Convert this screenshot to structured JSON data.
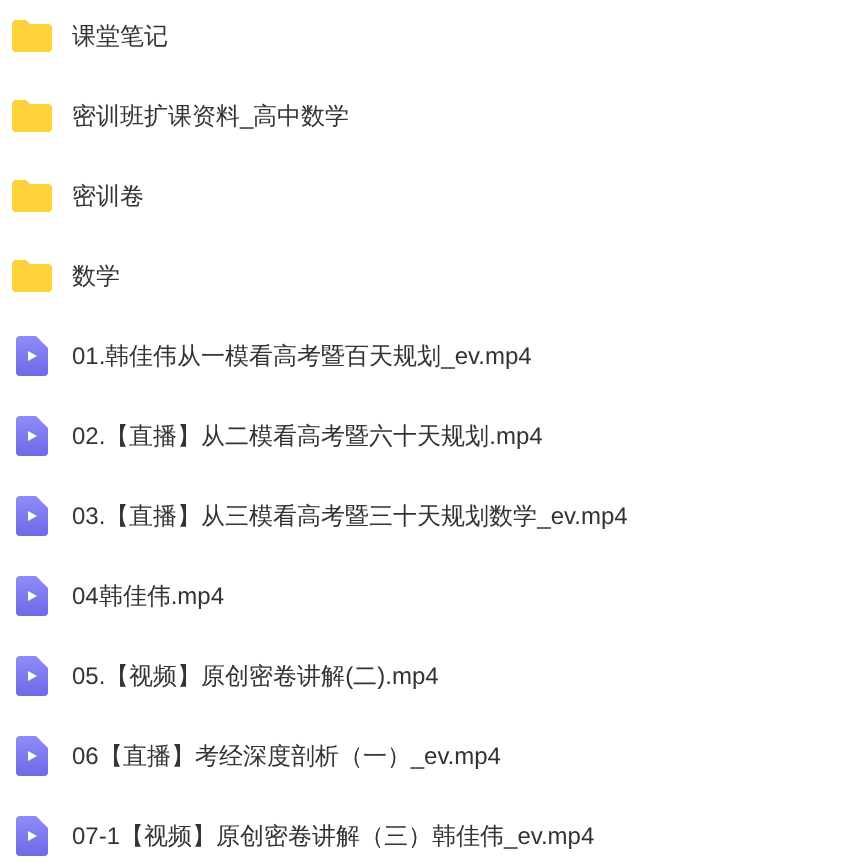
{
  "files": [
    {
      "kind": "folder",
      "name": "课堂笔记"
    },
    {
      "kind": "folder",
      "name": "密训班扩课资料_高中数学"
    },
    {
      "kind": "folder",
      "name": "密训卷"
    },
    {
      "kind": "folder",
      "name": "数学"
    },
    {
      "kind": "video",
      "name": "01.韩佳伟从一模看高考暨百天规划_ev.mp4"
    },
    {
      "kind": "video",
      "name": "02.【直播】从二模看高考暨六十天规划.mp4"
    },
    {
      "kind": "video",
      "name": "03.【直播】从三模看高考暨三十天规划数学_ev.mp4"
    },
    {
      "kind": "video",
      "name": "04韩佳伟.mp4"
    },
    {
      "kind": "video",
      "name": "05.【视频】原创密卷讲解(二).mp4"
    },
    {
      "kind": "video",
      "name": "06【直播】考经深度剖析（一）_ev.mp4"
    },
    {
      "kind": "video",
      "name": "07-1【视频】原创密卷讲解（三）韩佳伟_ev.mp4"
    }
  ]
}
